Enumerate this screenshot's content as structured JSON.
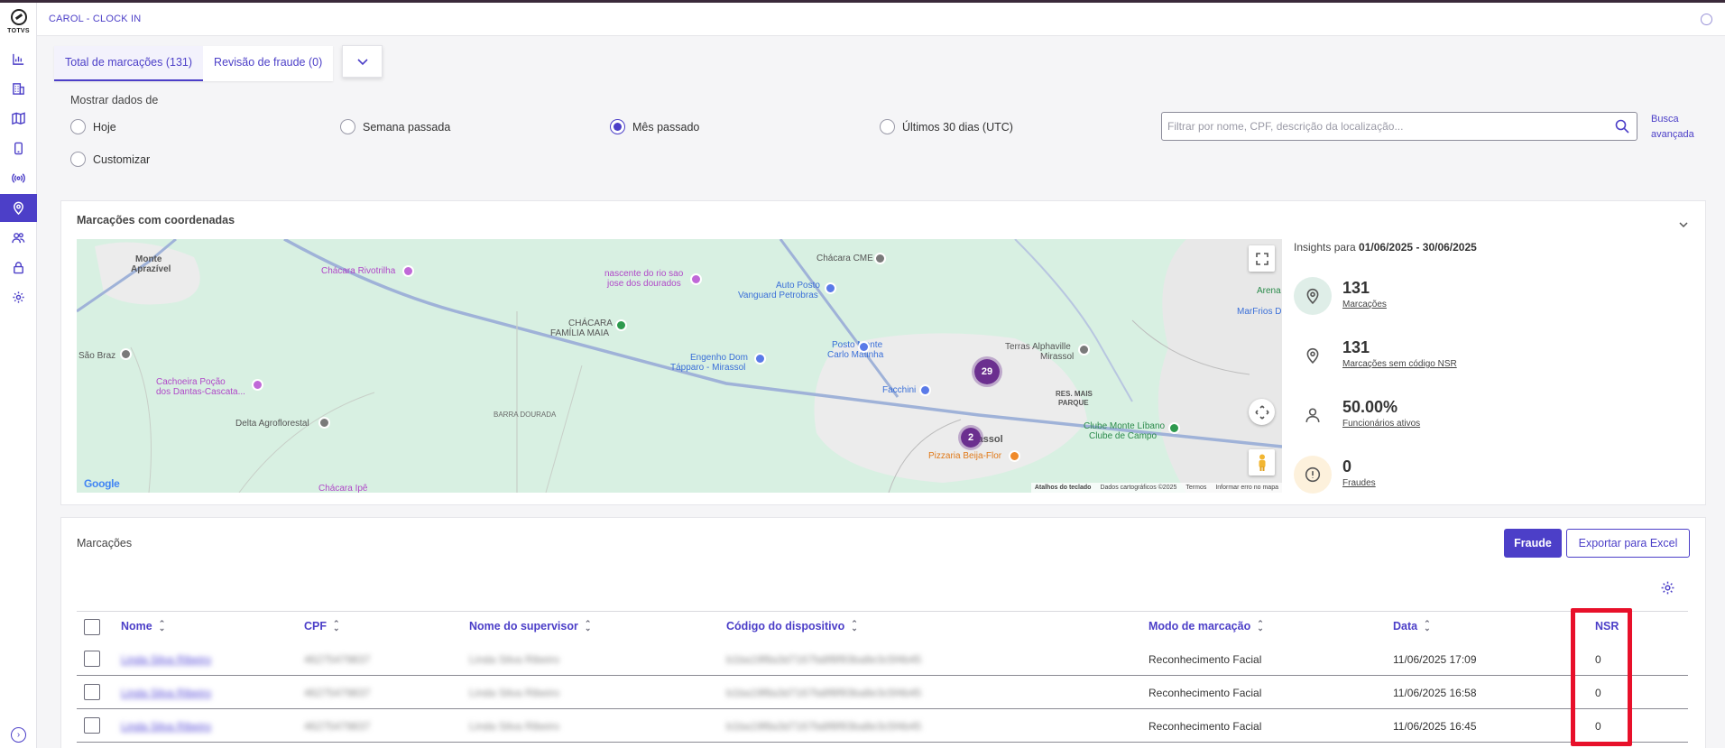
{
  "app": {
    "title": "CAROL - CLOCK IN",
    "logo_text": "TOTVS"
  },
  "sidebar": {
    "items": [
      {
        "icon": "chart-icon"
      },
      {
        "icon": "building-icon"
      },
      {
        "icon": "map-icon"
      },
      {
        "icon": "phone-icon"
      },
      {
        "icon": "broadcast-icon"
      },
      {
        "icon": "location-pin-icon",
        "active": true
      },
      {
        "icon": "users-icon"
      },
      {
        "icon": "lock-icon"
      },
      {
        "icon": "gear-icon"
      }
    ]
  },
  "tabs": [
    {
      "label": "Total de marcações (131)",
      "active": true
    },
    {
      "label": "Revisão de fraude (0)",
      "active": false
    }
  ],
  "filters": {
    "label": "Mostrar dados de",
    "options": [
      {
        "label": "Hoje",
        "selected": false
      },
      {
        "label": "Semana passada",
        "selected": false
      },
      {
        "label": "Mês passado",
        "selected": true
      },
      {
        "label": "Últimos 30 dias (UTC)",
        "selected": false
      },
      {
        "label": "Customizar",
        "selected": false
      }
    ],
    "search_placeholder": "Filtrar por nome, CPF, descrição da localização...",
    "advanced_search_line1": "Busca",
    "advanced_search_line2": "avançada"
  },
  "map_card": {
    "title": "Marcações com coordenadas",
    "places": {
      "monte1": "Monte",
      "monte2": "Aprazível",
      "rivotrilha": "Chácara Rivotrilha",
      "nascente1": "nascente do rio sao",
      "nascente2": "jose dos dourados",
      "chacara_cme": "Chácara CME",
      "auto1": "Auto Posto",
      "auto2": "Vanguard Petrobras",
      "familia1": "CHÁCARA",
      "familia2": "FAMÍLIA MAIA",
      "saobraz": "São Braz",
      "engenho1": "Engenho Dom",
      "engenho2": "Tápparo - Mirassol",
      "posto1": "Posto Monte",
      "posto2": "Carlo Matinha",
      "cachoeira1": "Cachoeira Poção",
      "cachoeira2": "dos Dantas-Cascata...",
      "delta": "Delta Agroflorestal",
      "facchini": "Facchini",
      "terras1": "Terras Alphaville",
      "terras2": "Mirassol",
      "res1": "RES. MAIS",
      "res2": "PARQUE",
      "clube1": "Clube Monte Líbano",
      "clube2": "Clube de Campo",
      "pizzaria": "Pizzaria Beija-Flor",
      "mirassol": "Mirassol",
      "barra": "BARRA DOURADA",
      "arena": "Arena",
      "marfrios": "MarFrios D",
      "chacara_ipe": "Chácara Ipê"
    },
    "clusters": [
      "29",
      "2"
    ],
    "google": "Google",
    "attribution": [
      "Atalhos do teclado",
      "Dados cartográficos ©2025",
      "Termos",
      "Informar erro no mapa"
    ]
  },
  "insights": {
    "title_prefix": "Insights para ",
    "period": "01/06/2025 - 30/06/2025",
    "items": [
      {
        "value": "131",
        "label": "Marcações",
        "icon": "location-pin-icon",
        "bg": "#dfeee8"
      },
      {
        "value": "131",
        "label": "Marcações sem código NSR",
        "icon": "location-pin-icon",
        "bg": "#ffffff"
      },
      {
        "value": "50.00%",
        "label": "Funcionários ativos",
        "icon": "person-icon",
        "bg": "#ffffff"
      },
      {
        "value": "0",
        "label": "Fraudes",
        "icon": "alert-icon",
        "bg": "#fdf1dc"
      }
    ]
  },
  "table_card": {
    "title": "Marcações",
    "fraud_button": "Fraude",
    "export_button": "Exportar para Excel",
    "columns": [
      "Nome",
      "CPF",
      "Nome do supervisor",
      "Código do dispositivo",
      "Modo de marcação",
      "Data",
      "NSR"
    ],
    "rows": [
      {
        "nome": "Linda Silva Ribeiro",
        "cpf": "46275479837",
        "supervisor": "Linda Silva Ribeiro",
        "device": "b1ba19f8a3d7167fa8f8f93ba8e3c5f4b45",
        "mode": "Reconhecimento Facial",
        "date": "11/06/2025 17:09",
        "nsr": "0"
      },
      {
        "nome": "Linda Silva Ribeiro",
        "cpf": "46275479837",
        "supervisor": "Linda Silva Ribeiro",
        "device": "b1ba19f8a3d7167fa8f8f93ba8e3c5f4b45",
        "mode": "Reconhecimento Facial",
        "date": "11/06/2025 16:58",
        "nsr": "0"
      },
      {
        "nome": "Linda Silva Ribeiro",
        "cpf": "46275479837",
        "supervisor": "Linda Silva Ribeiro",
        "device": "b1ba19f8a3d7167fa8f8f93ba8e3c5f4b45",
        "mode": "Reconhecimento Facial",
        "date": "11/06/2025 16:45",
        "nsr": "0"
      }
    ]
  },
  "colors": {
    "accent": "#4c3fc8",
    "highlight": "#e8102a",
    "map_bg": "#d8f0e2"
  }
}
